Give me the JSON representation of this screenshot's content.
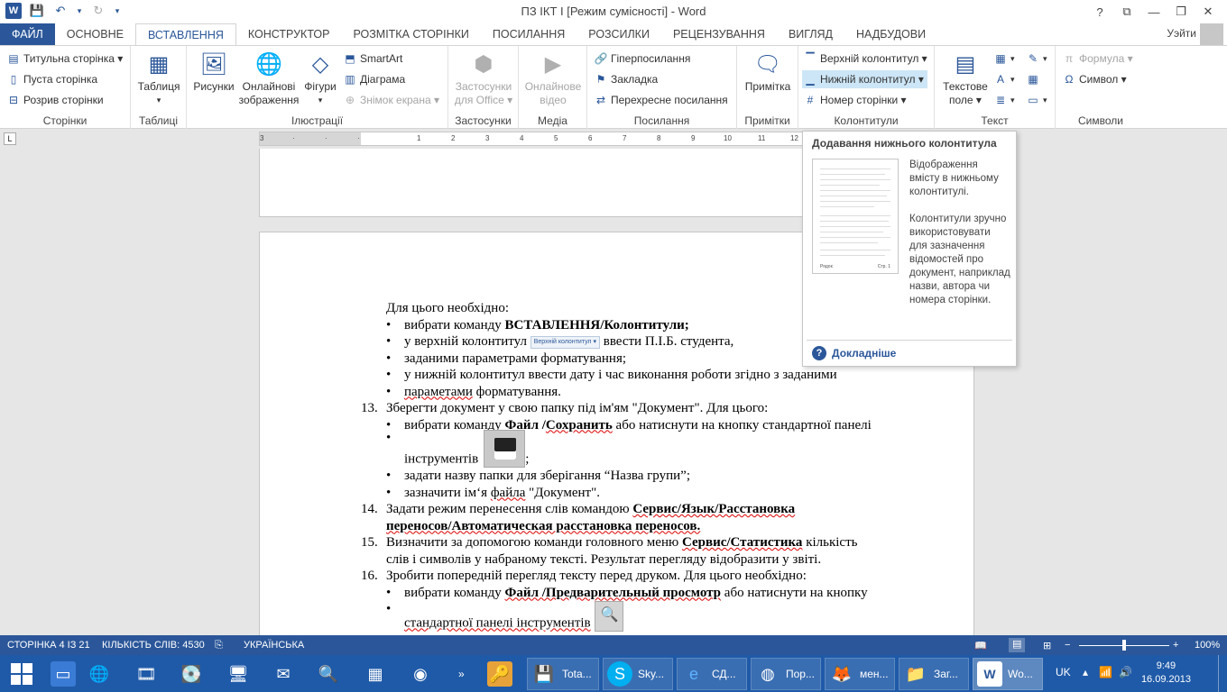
{
  "window": {
    "title": "ПЗ ІКТ І [Режим сумісності] - Word",
    "help": "?",
    "ribbon_display": "⧉",
    "minimize": "—",
    "maximize": "❐",
    "close": "✕"
  },
  "qat": {
    "word": "W",
    "save": "💾",
    "undo": "↶",
    "undo_drop": "▾",
    "redo": "↻",
    "customize": "▾"
  },
  "tabs": [
    "ФАЙЛ",
    "ОСНОВНЕ",
    "ВСТАВЛЕННЯ",
    "КОНСТРУКТОР",
    "РОЗМІТКА СТОРІНКИ",
    "ПОСИЛАННЯ",
    "РОЗСИЛКИ",
    "РЕЦЕНЗУВАННЯ",
    "ВИГЛЯД",
    "НАДБУДОВИ"
  ],
  "active_tab": "ВСТАВЛЕННЯ",
  "user": "Уэйти",
  "ribbon": {
    "pages": {
      "label": "Сторінки",
      "cover": "Титульна сторінка ▾",
      "blank": "Пуста сторінка",
      "break": "Розрив сторінки"
    },
    "tables": {
      "label": "Таблиці",
      "table": "Таблиця",
      "table2": "▾"
    },
    "illustrations": {
      "label": "Ілюстрації",
      "pictures": "Рисунки",
      "online1": "Онлайнові",
      "online2": "зображення",
      "shapes": "Фігури",
      "shapes2": "▾",
      "smartart": "SmartArt",
      "chart": "Діаграма",
      "screenshot": "Знімок екрана ▾"
    },
    "apps": {
      "label": "Застосунки",
      "l1": "Застосунки",
      "l2": "для Office ▾"
    },
    "media": {
      "label": "Медіа",
      "l1": "Онлайнове",
      "l2": "відео"
    },
    "links": {
      "label": "Посилання",
      "hyperlink": "Гіперпосилання",
      "bookmark": "Закладка",
      "crossref": "Перехресне посилання"
    },
    "comments": {
      "label": "Примітки",
      "comment": "Примітка"
    },
    "headerfooter": {
      "label": "Колонтитули",
      "header": "Верхній колонтитул ▾",
      "footer": "Нижній колонтитул ▾",
      "pagenum": "Номер сторінки ▾"
    },
    "text": {
      "label": "Текст",
      "textbox1": "Текстове",
      "textbox2": "поле ▾"
    },
    "symbols": {
      "label": "Символи",
      "equation": "Формула ▾",
      "symbol": "Символ ▾"
    }
  },
  "ruler": {
    "ticks": [
      "3",
      "1",
      "2",
      "1",
      "1",
      "2",
      "3",
      "4",
      "5",
      "6",
      "7",
      "8",
      "9",
      "10",
      "11",
      "12",
      "13"
    ],
    "tabstop": "L"
  },
  "vruler": {
    "ticks": [
      "2",
      "1",
      "1",
      "2",
      "3",
      "4",
      "5",
      "6",
      "7",
      "8",
      "9"
    ]
  },
  "document": {
    "intro": "Для цього необхідно:",
    "b1_pre": "вибрати команду ",
    "b1_bold": "ВСТАВЛЕННЯ/Колонтитули;",
    "b2_pre": "у верхній колонтитул ",
    "b2_btn": "Верхній колонтитул ▾",
    "b2_post": " ввести П.І.Б. студента,",
    "b2_cont": "заданими параметрами форматування;",
    "b3": "у нижній колонтитул ввести дату і час виконання роботи згідно з заданими",
    "b3_cont_err": "параметами",
    "b3_cont": " форматування.",
    "n13": "13.",
    "n13_text": "Зберегти документ у свою папку під ім'ям \"Документ\". Для цього:",
    "b4_pre": "вибрати команду ",
    "b4_bold1": "Файл /",
    "b4_bold_err": "Сохранить",
    "b4_post": " або натиснути на кнопку стандартної панелі",
    "b4_cont": "інструментів",
    "b4_end": ";",
    "b5": "задати назву папки для зберігання “Назва групи”;",
    "b6_pre": "зазначити ім‘я ",
    "b6_err": "файла",
    "b6_post": " \"Документ\".",
    "n14": "14.",
    "n14_pre": "Задати режим перенесення слів командою ",
    "n14_bold": "Сервис/Язык/Расстановка",
    "n14_cont": "переносов/Автоматическая расстановка переносов.",
    "n15": "15.",
    "n15_pre": "Визначити за допомогою команди головного меню ",
    "n15_bold": "Сервис/Статистика",
    "n15_post": "  кількість",
    "n15_cont": " слів і символів у набраному тексті. Результат перегляду відобразити у звіті.",
    "n16": "16.",
    "n16_text": "Зробити попередній перегляд тексту перед друком. Для цього необхідно:",
    "b7_pre": "вибрати команду ",
    "b7_bold": "Файл /Предварительный просмотр",
    "b7_post": "  або натиснути на кнопку",
    "b7_cont": "стандартної панелі інструментів"
  },
  "tooltip": {
    "title": "Додавання нижнього колонтитула",
    "desc1": "Відображення вмісту в нижньому колонтитулі.",
    "desc2": "Колонтитули зручно використовувати для зазначення відомостей про документ, наприклад назви, автора чи номера сторінки.",
    "more": "Докладніше",
    "thumb_left": "Рядок",
    "thumb_right": "Стр. 1"
  },
  "status": {
    "page": "СТОРІНКА 4 ІЗ 21",
    "words": "КІЛЬКІСТЬ СЛІВ: 4530",
    "lang": "УКРАЇНСЬКА",
    "zoom": "100%",
    "zoom_minus": "−",
    "zoom_plus": "+"
  },
  "taskbar": {
    "items": [
      "Tota...",
      "Sky...",
      "СД...",
      "Пор...",
      "мен...",
      "Заг...",
      "Wo..."
    ],
    "lang": "UK",
    "time": "9:49",
    "date": "16.09.2013",
    "chevron": "»"
  },
  "colors": {
    "accent": "#2b579a",
    "taskbar": "#1f5aa8"
  }
}
